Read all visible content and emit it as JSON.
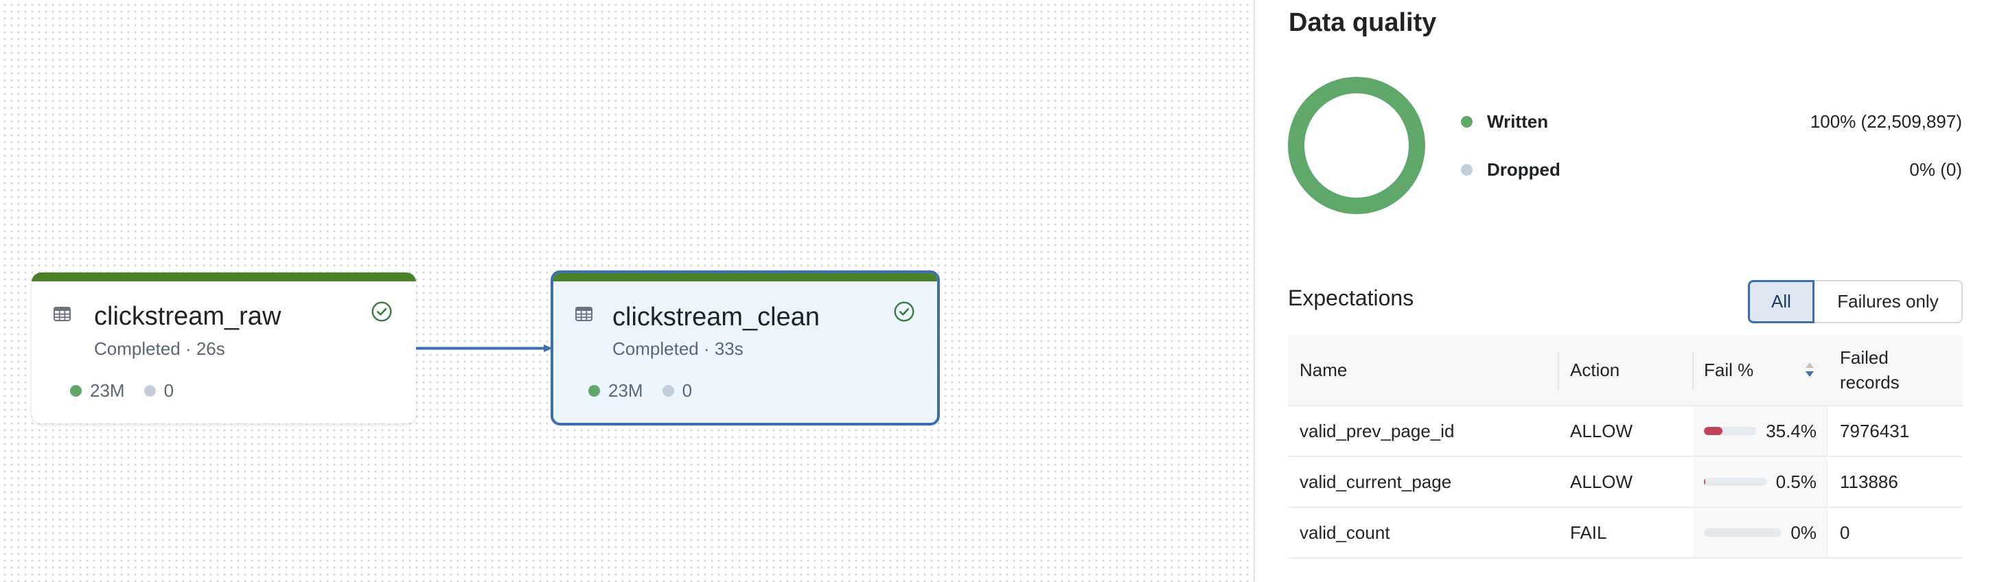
{
  "canvas": {
    "nodes": [
      {
        "name": "clickstream_raw",
        "status": "Completed · 26s",
        "icon": "table-icon",
        "status_icon": "check-circle-icon",
        "written": "23M",
        "dropped": "0",
        "selected": false
      },
      {
        "name": "clickstream_clean",
        "status": "Completed · 33s",
        "icon": "table-icon",
        "status_icon": "check-circle-icon",
        "written": "23M",
        "dropped": "0",
        "selected": true
      }
    ],
    "edges": [
      {
        "from": "clickstream_raw",
        "to": "clickstream_clean"
      }
    ]
  },
  "data_quality": {
    "title": "Data quality",
    "legend": [
      {
        "label": "Written",
        "value": "100% (22,509,897)",
        "color": "#5fa86a",
        "fraction": 1.0
      },
      {
        "label": "Dropped",
        "value": "0% (0)",
        "color": "#c3cedb",
        "fraction": 0.0
      }
    ]
  },
  "expectations": {
    "title": "Expectations",
    "filter": {
      "options": [
        "All",
        "Failures only"
      ],
      "selected": "All"
    },
    "columns": [
      "Name",
      "Action",
      "Fail %",
      "Failed records"
    ],
    "sort": {
      "column": "Fail %",
      "direction": "descending"
    },
    "rows": [
      {
        "name": "valid_prev_page_id",
        "action": "ALLOW",
        "fail_pct": "35.4%",
        "fail_fraction": 0.354,
        "failed_records": "7976431"
      },
      {
        "name": "valid_current_page",
        "action": "ALLOW",
        "fail_pct": "0.5%",
        "fail_fraction": 0.005,
        "failed_records": "113886"
      },
      {
        "name": "valid_count",
        "action": "FAIL",
        "fail_pct": "0%",
        "fail_fraction": 0.0,
        "failed_records": "0"
      }
    ]
  },
  "colors": {
    "success": "#4b8128",
    "selected_border": "#3d6fae",
    "selected_bg": "#edf5fd",
    "written": "#5fa86a",
    "dropped": "#c3cedb",
    "fail_bar": "#c0455a"
  }
}
